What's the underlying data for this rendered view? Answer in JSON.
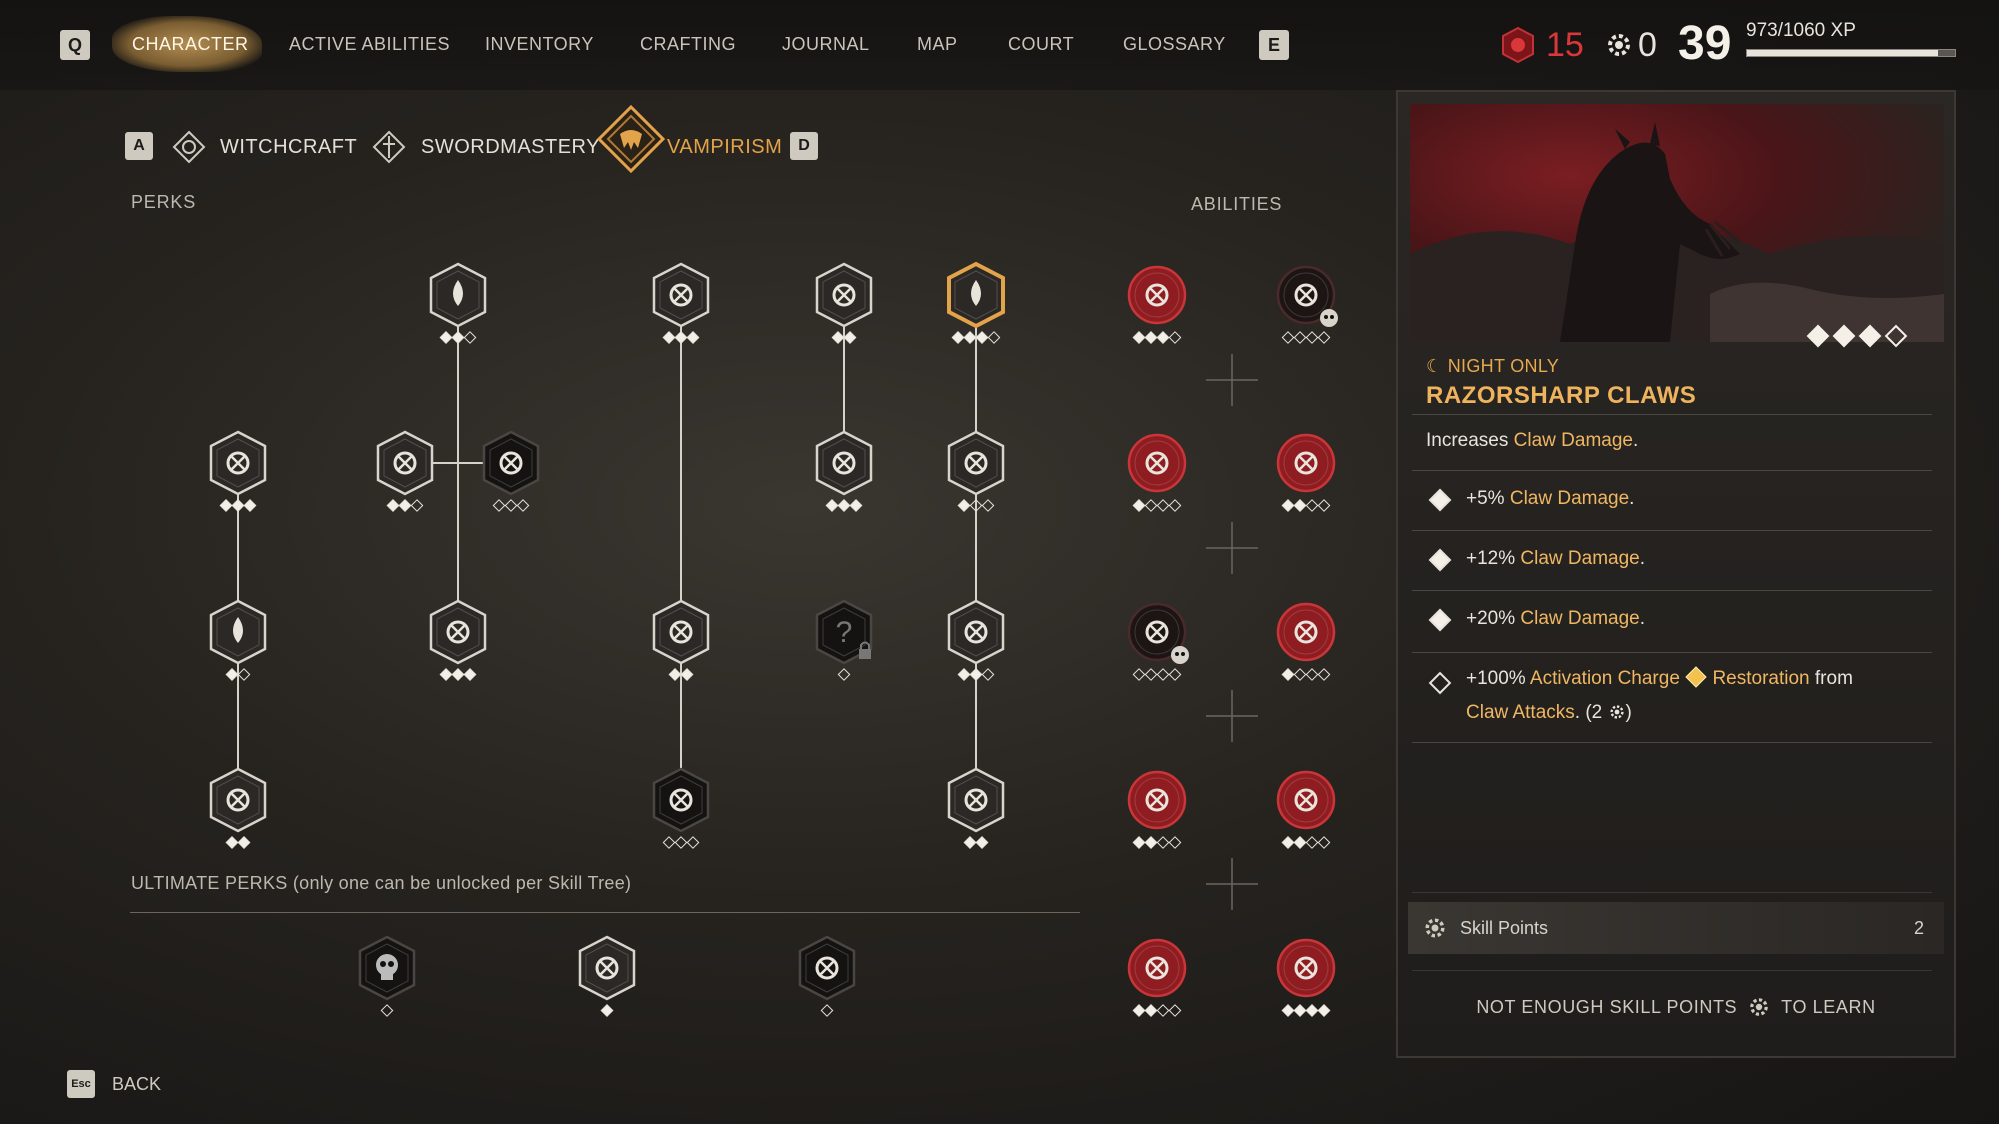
{
  "nav": {
    "left_key": "Q",
    "right_key": "E",
    "items": [
      "CHARACTER",
      "ACTIVE ABILITIES",
      "INVENTORY",
      "CRAFTING",
      "JOURNAL",
      "MAP",
      "COURT",
      "GLOSSARY"
    ],
    "active": "CHARACTER"
  },
  "resources": {
    "blood_count": "15",
    "skill_points_count": "0",
    "level": "39",
    "xp_text": "973/1060 XP",
    "xp_fraction": 0.918
  },
  "trees": {
    "left_key": "A",
    "right_key": "D",
    "tabs": [
      "WITCHCRAFT",
      "SWORDMASTERY",
      "VAMPIRISM"
    ],
    "active": "VAMPIRISM"
  },
  "labels": {
    "perks": "PERKS",
    "abilities": "ABILITIES",
    "ultimate": "ULTIMATE PERKS (only one can be unlocked per Skill Tree)"
  },
  "perk_nodes": [
    {
      "id": "p1",
      "icon": "blood-drop-icon",
      "state": "unlocked",
      "dots": [
        1,
        1,
        0
      ]
    },
    {
      "id": "p2",
      "icon": "fang-mouth-icon",
      "state": "unlocked",
      "dots": [
        1,
        1,
        1
      ]
    },
    {
      "id": "p3",
      "icon": "eye-sigil-icon",
      "state": "unlocked",
      "dots": [
        1,
        1
      ]
    },
    {
      "id": "p4",
      "icon": "blood-rain-icon",
      "state": "selected",
      "dots": [
        1,
        1,
        1,
        0
      ]
    },
    {
      "id": "p5",
      "icon": "flame-hand-icon",
      "state": "unlocked",
      "dots": [
        1,
        1,
        1
      ]
    },
    {
      "id": "p6",
      "icon": "fangs-icon",
      "state": "unlocked",
      "dots": [
        1,
        1,
        0
      ]
    },
    {
      "id": "p7",
      "icon": "sun-sigil-icon",
      "state": "locked",
      "dots": [
        0,
        0,
        0
      ]
    },
    {
      "id": "p8",
      "icon": "stake-icon",
      "state": "unlocked",
      "dots": [
        1,
        1,
        1
      ]
    },
    {
      "id": "p9",
      "icon": "slash-icon",
      "state": "unlocked",
      "dots": [
        1,
        0,
        0
      ]
    },
    {
      "id": "p10",
      "icon": "blood-drops-icon",
      "state": "unlocked",
      "dots": [
        1,
        0
      ]
    },
    {
      "id": "p11",
      "icon": "grab-hand-icon",
      "state": "unlocked",
      "dots": [
        1,
        1,
        1
      ]
    },
    {
      "id": "p12",
      "icon": "claw-marks-icon",
      "state": "unlocked",
      "dots": [
        1,
        1
      ]
    },
    {
      "id": "p13",
      "icon": "question-lock-icon",
      "state": "hidden",
      "dots": [
        0
      ]
    },
    {
      "id": "p14",
      "icon": "claw-icon",
      "state": "unlocked",
      "dots": [
        1,
        1,
        0
      ]
    },
    {
      "id": "p15",
      "icon": "eye-shield-icon",
      "state": "unlocked",
      "dots": [
        1,
        1
      ]
    },
    {
      "id": "p16",
      "icon": "bat-drop-icon",
      "state": "locked",
      "dots": [
        0,
        0,
        0
      ]
    },
    {
      "id": "p17",
      "icon": "claw-hand-icon",
      "state": "unlocked",
      "dots": [
        1,
        1
      ]
    }
  ],
  "ultimate_nodes": [
    {
      "id": "u1",
      "icon": "skull-icon",
      "state": "locked",
      "dots": [
        0
      ]
    },
    {
      "id": "u2",
      "icon": "ghost-skull-icon",
      "state": "unlocked",
      "dots": [
        1
      ]
    },
    {
      "id": "u3",
      "icon": "spiral-sigil-icon",
      "state": "locked",
      "dots": [
        0
      ]
    }
  ],
  "ability_nodes": [
    {
      "id": "a1",
      "icon": "roar-mouth-icon",
      "state": "unlocked",
      "dots": [
        1,
        1,
        1,
        0
      ]
    },
    {
      "id": "a2",
      "icon": "dark-beast-icon",
      "state": "locked",
      "dots": [
        0,
        0,
        0,
        0
      ],
      "skull": true
    },
    {
      "id": "a3",
      "icon": "wolf-head-icon",
      "state": "unlocked",
      "dots": [
        1,
        0,
        0,
        0
      ]
    },
    {
      "id": "a4",
      "icon": "burst-icon",
      "state": "unlocked",
      "dots": [
        1,
        1,
        0,
        0
      ]
    },
    {
      "id": "a5",
      "icon": "vortex-icon",
      "state": "locked",
      "dots": [
        0,
        0,
        0,
        0
      ],
      "skull": true
    },
    {
      "id": "a6",
      "icon": "bat-swarm-icon",
      "state": "unlocked",
      "dots": [
        1,
        0,
        0,
        0
      ]
    },
    {
      "id": "a7",
      "icon": "spider-icon",
      "state": "unlocked",
      "dots": [
        1,
        1,
        0,
        0
      ]
    },
    {
      "id": "a8",
      "icon": "heart-icon",
      "state": "unlocked",
      "dots": [
        1,
        1,
        0,
        0
      ]
    },
    {
      "id": "a9",
      "icon": "razor-claws-icon",
      "state": "unlocked",
      "dots": [
        1,
        1,
        0,
        0
      ]
    },
    {
      "id": "a10",
      "icon": "blood-claw-icon",
      "state": "unlocked",
      "dots": [
        1,
        1,
        1,
        1
      ]
    }
  ],
  "detail": {
    "tag": "NIGHT ONLY",
    "title": "RAZORSHARP CLAWS",
    "preview_dots": [
      1,
      1,
      1,
      0
    ],
    "desc_prefix": "Increases ",
    "desc_hl": "Claw Damage",
    "desc_suffix": ".",
    "bonuses": [
      {
        "on": true,
        "prefix": "+5% ",
        "hl": "Claw Damage",
        "suffix": "."
      },
      {
        "on": true,
        "prefix": "+12% ",
        "hl": "Claw Damage",
        "suffix": "."
      },
      {
        "on": true,
        "prefix": "+20% ",
        "hl": "Claw Damage",
        "suffix": "."
      }
    ],
    "last_bonus": {
      "on": false,
      "p1": "+100% ",
      "h1": "Activation Charge",
      "h2": "Restoration",
      "p2": " from",
      "h3": "Claw Attacks",
      "p3": ". (2",
      "p4": ")"
    },
    "skill_points_label": "Skill Points",
    "skill_points_value": "2",
    "learn_prefix": "NOT ENOUGH SKILL POINTS",
    "learn_suffix": "TO LEARN"
  },
  "footer": {
    "back_key": "Esc",
    "back_label": "BACK"
  },
  "colors": {
    "accent": "#efb35e",
    "blood": "#d9373a",
    "ability_red": "#9c1e22"
  }
}
